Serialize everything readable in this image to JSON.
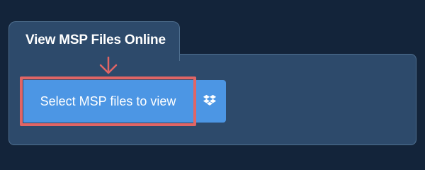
{
  "tab": {
    "title": "View MSP Files Online"
  },
  "actions": {
    "select_label": "Select MSP files to view",
    "dropbox_icon": "dropbox-icon"
  },
  "colors": {
    "background": "#13243a",
    "panel": "#2d4a6b",
    "button": "#4c96e4",
    "highlight": "#e06565"
  }
}
